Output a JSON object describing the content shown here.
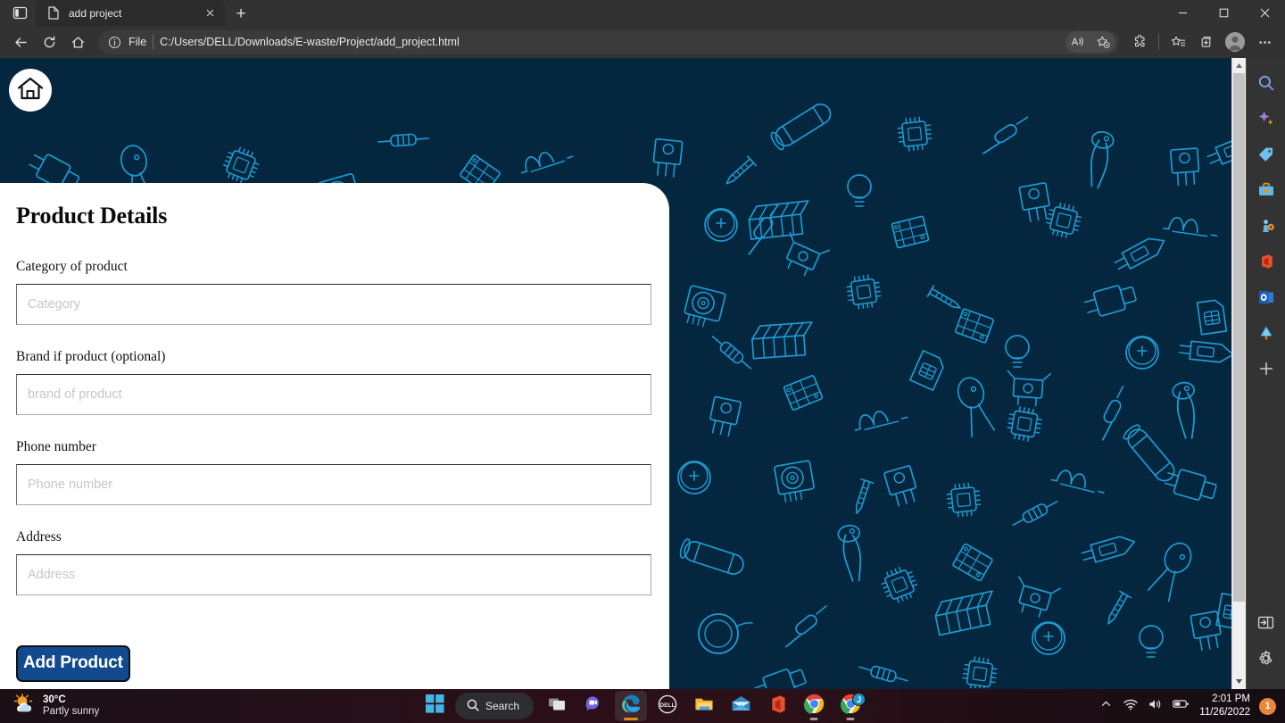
{
  "browser": {
    "tab_sidebar_icon": "split-pane-icon",
    "tab": {
      "title": "add project",
      "favicon": "document-icon",
      "close_icon": "close-icon"
    },
    "new_tab_label": "+",
    "window_controls": {
      "minimize": "minimize-icon",
      "maximize": "maximize-icon",
      "close": "close-icon"
    },
    "toolbar": {
      "back_icon": "back-arrow-icon",
      "refresh_icon": "refresh-icon",
      "home_icon": "home-icon",
      "info_icon": "info-circle-icon",
      "scheme_label": "File",
      "url": "C:/Users/DELL/Downloads/E-waste/Project/add_project.html",
      "read_aloud_icon": "read-aloud-icon",
      "add_favorite_icon": "add-favorite-star-icon",
      "extensions_icon": "extensions-puzzle-icon",
      "favorites_icon": "favorites-star-list-icon",
      "collections_icon": "collections-icon",
      "profile_icon": "profile-avatar-icon",
      "settings_icon": "more-settings-ellipsis-icon"
    }
  },
  "sidebar": {
    "items": [
      {
        "name": "search",
        "icon": "search-icon"
      },
      {
        "name": "copilot",
        "icon": "copilot-sparkle-icon"
      },
      {
        "name": "shopping",
        "icon": "price-tag-icon"
      },
      {
        "name": "tools",
        "icon": "toolbox-icon"
      },
      {
        "name": "games",
        "icon": "games-icon"
      },
      {
        "name": "office",
        "icon": "office-icon"
      },
      {
        "name": "outlook",
        "icon": "outlook-icon"
      },
      {
        "name": "drop",
        "icon": "drop-tree-icon"
      },
      {
        "name": "customize",
        "icon": "plus-icon"
      }
    ],
    "bottom": [
      {
        "name": "collapse",
        "icon": "collapse-panel-icon"
      },
      {
        "name": "settings",
        "icon": "gear-icon"
      }
    ]
  },
  "page": {
    "home_badge_icon": "home-icon",
    "background": {
      "color": "#05263f",
      "line_color": "#1d9fd4",
      "motif": "electronics-components-line-pattern"
    },
    "card": {
      "title": "Product Details",
      "fields": [
        {
          "label": "Category of product",
          "placeholder": "Category",
          "value": ""
        },
        {
          "label": "Brand if product (optional)",
          "placeholder": "brand of product",
          "value": ""
        },
        {
          "label": "Phone number",
          "placeholder": "Phone number",
          "value": ""
        },
        {
          "label": "Address",
          "placeholder": "Address",
          "value": ""
        }
      ],
      "submit_label": "Add Product",
      "submit_color": "#134a8e"
    },
    "scrollbar": {
      "up_arrow": "scroll-up-icon",
      "down_arrow": "scroll-down-icon"
    }
  },
  "taskbar": {
    "weather": {
      "icon": "sun-behind-cloud-icon",
      "temperature": "30°C",
      "condition": "Partly sunny"
    },
    "start_icon": "windows-start-icon",
    "search_label": "Search",
    "search_icon": "search-icon",
    "apps": [
      {
        "name": "task-view",
        "icon": "task-view-icon"
      },
      {
        "name": "chat",
        "icon": "chat-video-icon"
      },
      {
        "name": "microsoft-edge",
        "icon": "edge-icon"
      },
      {
        "name": "dell",
        "icon": "dell-icon"
      },
      {
        "name": "file-explorer",
        "icon": "file-explorer-icon"
      },
      {
        "name": "mail",
        "icon": "mail-icon"
      },
      {
        "name": "office",
        "icon": "office-icon"
      },
      {
        "name": "google-chrome",
        "icon": "chrome-icon"
      },
      {
        "name": "chrome-beta",
        "icon": "chrome-icon"
      }
    ],
    "chrome_beta_badge": "J",
    "tray": {
      "show_hidden_icon": "chevron-up-icon",
      "network_icon": "wifi-icon",
      "volume_icon": "speaker-icon",
      "battery_icon": "battery-icon",
      "time": "2:01 PM",
      "date": "11/26/2022",
      "notification_count": "1"
    }
  }
}
